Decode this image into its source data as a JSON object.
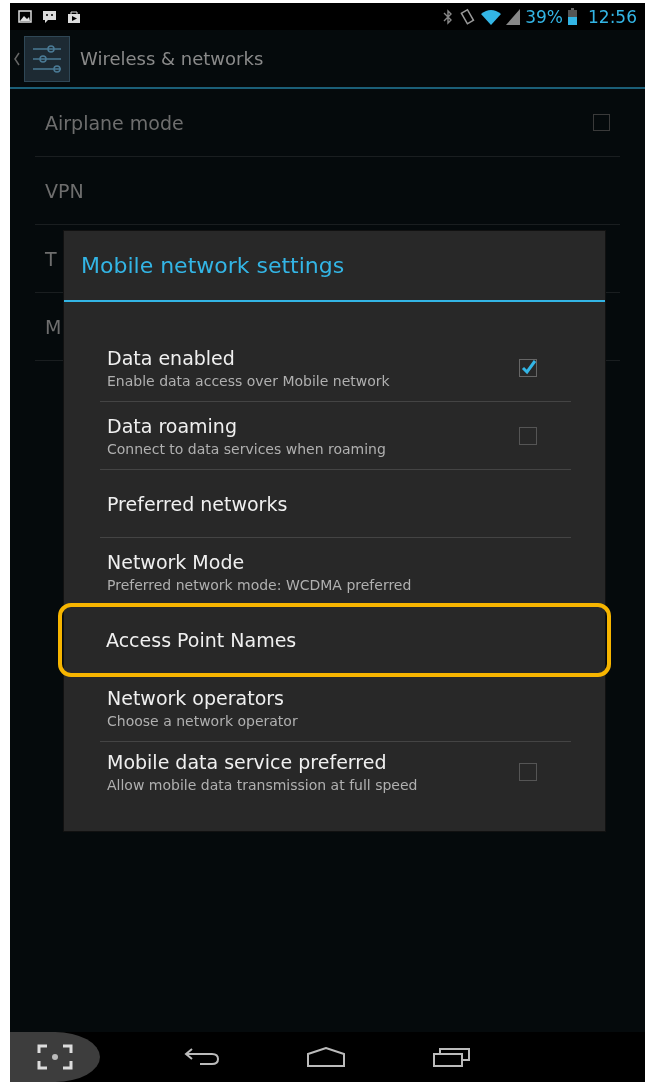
{
  "status_bar": {
    "battery": "39%",
    "time": "12:56"
  },
  "action_bar": {
    "title": "Wireless & networks"
  },
  "background_items": [
    {
      "label": "Airplane mode",
      "kind": "checkbox",
      "checked": false
    },
    {
      "label": "VPN",
      "kind": "plain"
    },
    {
      "label": "T",
      "kind": "plain"
    },
    {
      "label": "M",
      "kind": "plain"
    }
  ],
  "dialog": {
    "title": "Mobile network settings",
    "items": [
      {
        "title": "Data enabled",
        "summary": "Enable data access over Mobile network",
        "kind": "checkbox",
        "checked": true,
        "highlighted": false
      },
      {
        "title": "Data roaming",
        "summary": "Connect to data services when roaming",
        "kind": "checkbox",
        "checked": false,
        "highlighted": false
      },
      {
        "title": "Preferred networks",
        "kind": "plain",
        "highlighted": false
      },
      {
        "title": "Network Mode",
        "summary": "Preferred network mode: WCDMA preferred",
        "kind": "plain",
        "highlighted": false
      },
      {
        "title": "Access Point Names",
        "kind": "plain",
        "highlighted": true
      },
      {
        "title": "Network operators",
        "summary": "Choose a network operator",
        "kind": "plain",
        "highlighted": false
      },
      {
        "title": "Mobile data service preferred",
        "summary": "Allow mobile data transmission at full speed",
        "kind": "checkbox",
        "checked": false,
        "highlighted": false
      }
    ]
  }
}
